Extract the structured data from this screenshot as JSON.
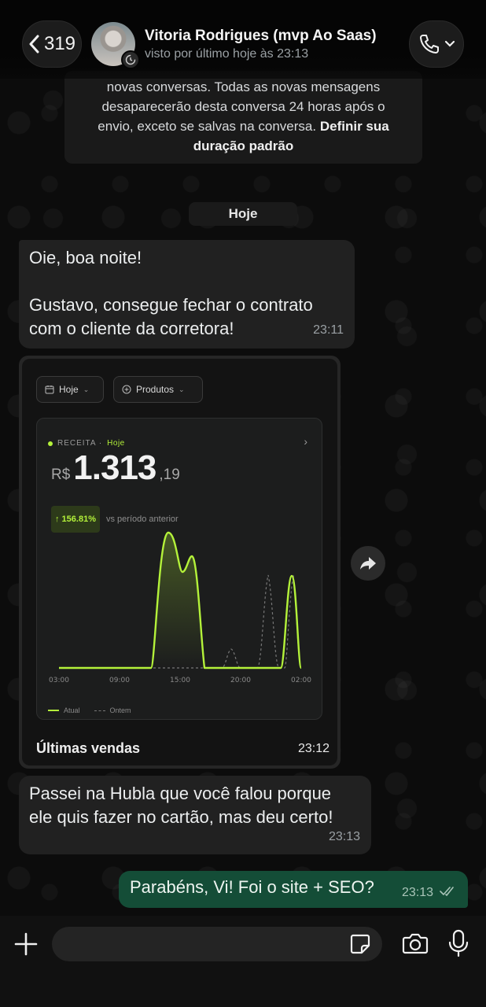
{
  "header": {
    "back_count": "319",
    "contact_name": "Vitoria Rodrigues (mvp Ao Saas)",
    "status": "visto por último hoje às 23:13"
  },
  "notice": {
    "line1": "novas conversas. Todas as novas mensagens",
    "line2": "desaparecerão desta conversa 24 horas após o",
    "line3": "envio, exceto se salvas na conversa.",
    "link": "Definir sua duração padrão"
  },
  "date_chip": "Hoje",
  "messages": [
    {
      "direction": "in",
      "line1": "Oie, boa noite!",
      "line2": "Gustavo, consegue fechar o contrato",
      "line3": "com o cliente da corretora!",
      "time": "23:11"
    },
    {
      "direction": "in",
      "type": "image",
      "time": "23:12",
      "screenshot": {
        "filter_date": "Hoje",
        "filter_products": "Produtos",
        "card_label": "RECEITA ·",
        "card_label_accent": "Hoje",
        "currency": "R$",
        "amount": "1.313",
        "cents": ",19",
        "delta": "↑ 156.81%",
        "delta_text": "vs período anterior",
        "legend_current": "Atual",
        "legend_previous": "Ontem",
        "section_title": "Últimas vendas"
      }
    },
    {
      "direction": "in",
      "line1": "Passei na Hubla que você falou porque",
      "line2": "ele quis fazer no cartão, mas deu certo!",
      "time": "23:13"
    },
    {
      "direction": "out",
      "text": "Parabéns, Vi! Foi o site + SEO?",
      "time": "23:13",
      "read": true
    }
  ],
  "composer": {
    "value": "",
    "placeholder": ""
  },
  "chart_data": {
    "type": "line",
    "x": [
      "03:00",
      "09:00",
      "15:00",
      "20:00",
      "02:00"
    ],
    "series": [
      {
        "name": "Atual",
        "color": "#b4f23a",
        "style": "solid"
      },
      {
        "name": "Ontem",
        "color": "#777777",
        "style": "dashed"
      }
    ],
    "grid": false,
    "legend": "bottom-left"
  },
  "colors": {
    "accent": "#b4f23a",
    "bubble_out": "#144d37",
    "bubble_in": "#212121"
  }
}
